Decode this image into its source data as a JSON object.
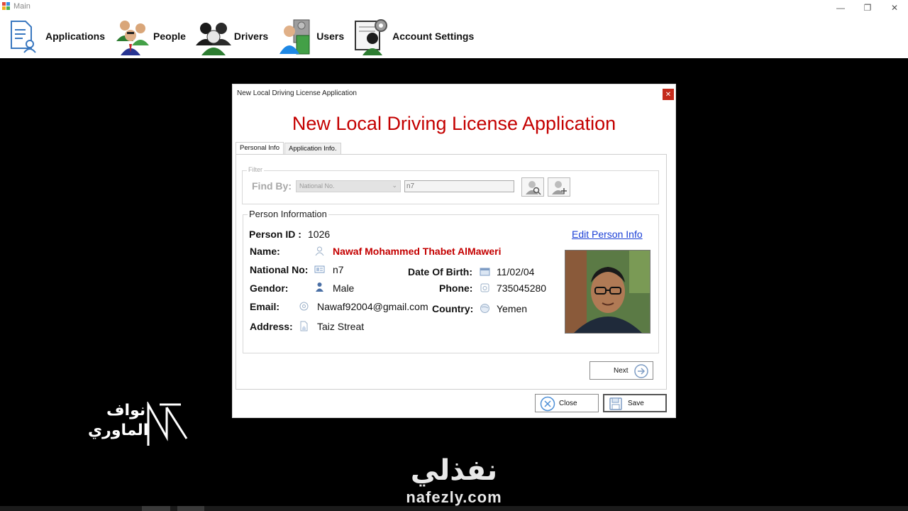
{
  "window": {
    "title": "Main",
    "controls": {
      "minimize": "—",
      "restore": "❐",
      "close": "✕"
    }
  },
  "toolbar": {
    "items": [
      {
        "label": "Applications",
        "icon": "applications-icon"
      },
      {
        "label": "People",
        "icon": "people-icon"
      },
      {
        "label": "Drivers",
        "icon": "drivers-icon"
      },
      {
        "label": "Users",
        "icon": "users-icon"
      },
      {
        "label": "Account Settings",
        "icon": "account-settings-icon"
      }
    ]
  },
  "dialog": {
    "title": "New Local Driving License Application",
    "close_glyph": "✕",
    "heading": "New Local Driving License Application",
    "tabs": [
      {
        "label": "Personal Info",
        "active": true
      },
      {
        "label": "Application Info.",
        "active": false
      }
    ],
    "filter": {
      "legend": "Filter",
      "find_by_label": "Find By:",
      "find_by_selected": "National No.",
      "find_by_value": "n7"
    },
    "person": {
      "legend": "Person Information",
      "person_id_label": "Person ID :",
      "person_id": "1026",
      "edit_link": "Edit Person Info",
      "name_label": "Name:",
      "name": "Nawaf Mohammed Thabet AlMaweri",
      "national_no_label": "National No:",
      "national_no": "n7",
      "dob_label": "Date Of Birth:",
      "dob": "11/02/04",
      "gender_label": "Gendor:",
      "gender": "Male",
      "phone_label": "Phone:",
      "phone": "735045280",
      "email_label": "Email:",
      "email": "Nawaf92004@gmail.com",
      "country_label": "Country:",
      "country": "Yemen",
      "address_label": "Address:",
      "address": "Taiz Streat"
    },
    "buttons": {
      "next": "Next",
      "close": "Close",
      "save": "Save"
    }
  },
  "watermarks": {
    "author_line1": "نواف",
    "author_line2": "الماوري",
    "site_arabic": "نفذلي",
    "site_url": "nafezly.com"
  },
  "colors": {
    "heading_red": "#c40000",
    "link_blue": "#1a3fd6",
    "close_red": "#c42b1c"
  }
}
